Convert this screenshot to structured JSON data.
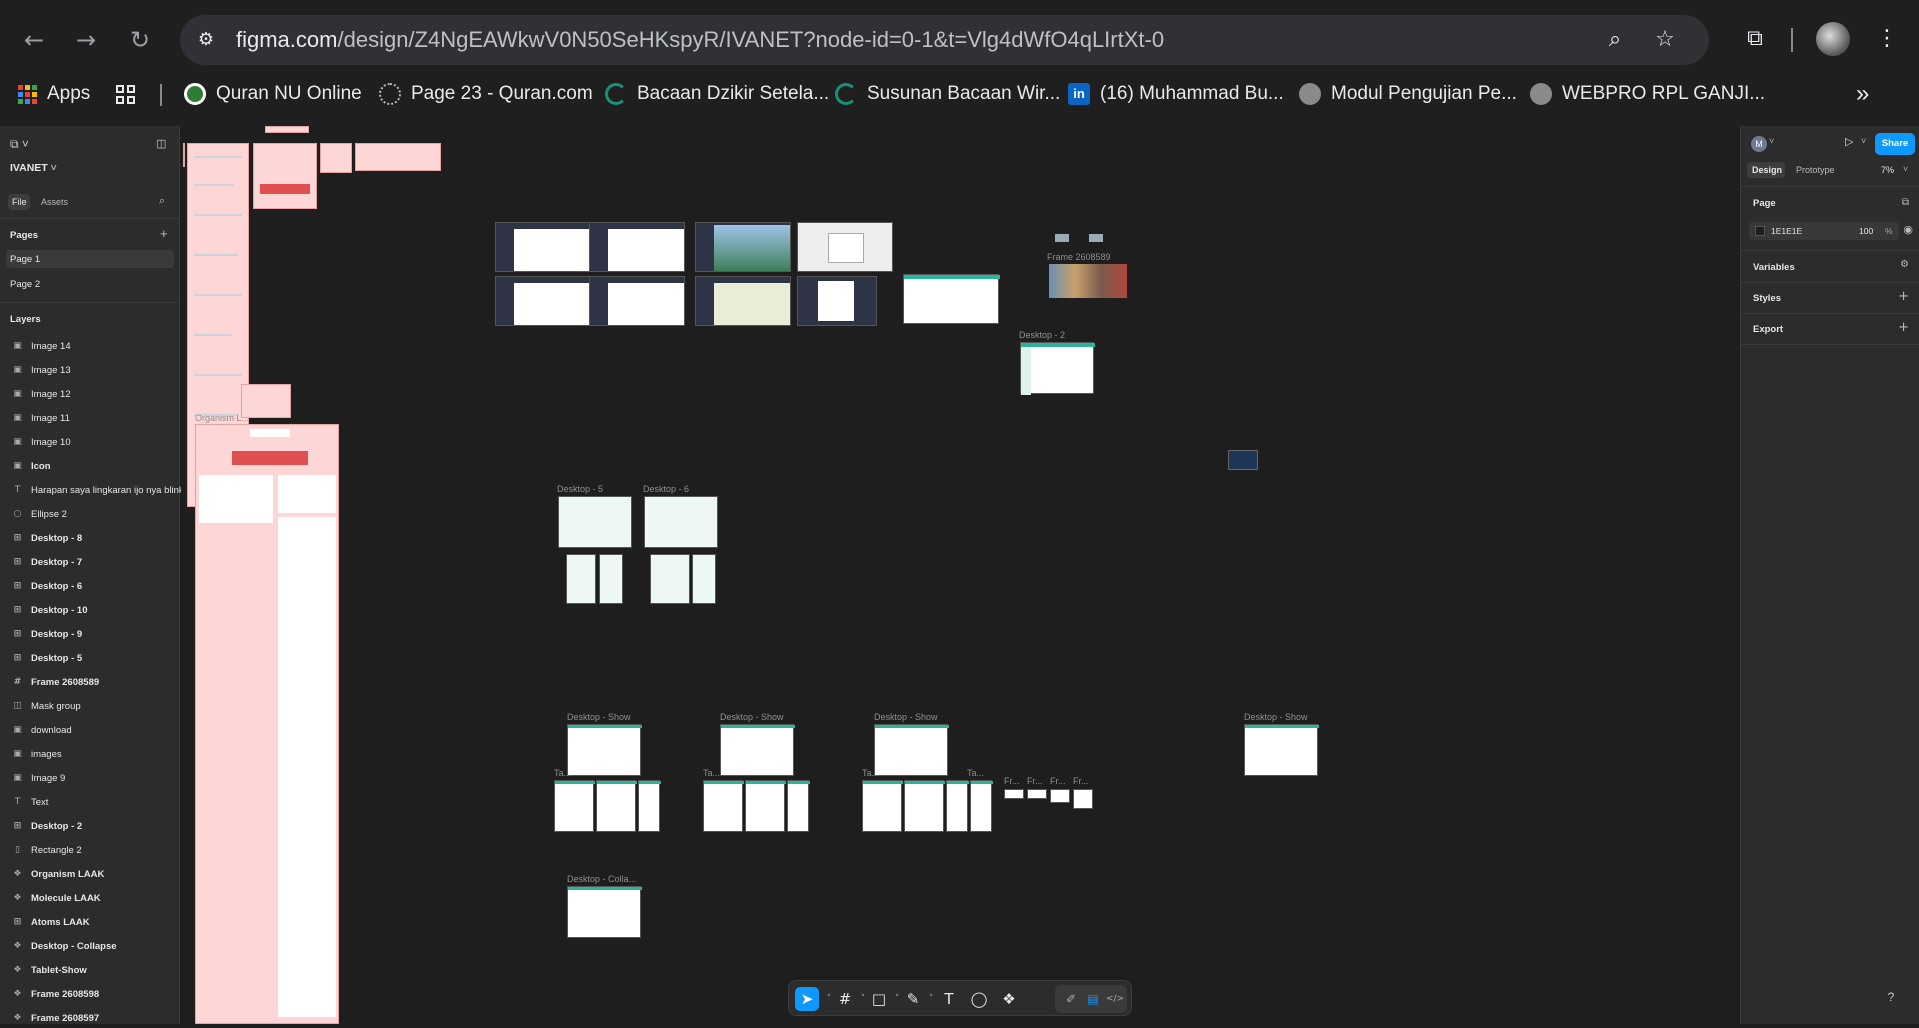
{
  "browser": {
    "url_host": "figma.com",
    "url_path": "/design/Z4NgEAWkwV0N50SeHKspyR/IVANET?node-id=0-1&t=Vlg4dWfO4qLIrtXt-0",
    "back_icon": "←",
    "forward_icon": "→",
    "reload_icon": "↻",
    "zoom_icon": "⌕",
    "star_icon": "☆",
    "extensions_icon": "⧉",
    "menu_icon": "⋮"
  },
  "bookmarks": [
    {
      "label": "Apps",
      "color": "#4285f4"
    },
    {
      "label": "Quran NU Online",
      "color": "#2e7d32"
    },
    {
      "label": "Page 23 - Quran.com",
      "color": "#6f6f6f"
    },
    {
      "label": "Bacaan Dzikir Setela...",
      "color": "#1a8f7a"
    },
    {
      "label": "Susunan Bacaan Wir...",
      "color": "#1a8f7a"
    },
    {
      "label": "(16) Muhammad Bu...",
      "color": "#0a66c2"
    },
    {
      "label": "Modul Pengujian Pe...",
      "color": "#8a8a8a"
    },
    {
      "label": "WEBPRO RPL GANJI...",
      "color": "#8a8a8a"
    }
  ],
  "bookmarks_more": "»",
  "left_panel": {
    "file_name": "IVANET",
    "tabs": {
      "file": "File",
      "assets": "Assets"
    },
    "pages_header": "Pages",
    "pages": [
      "Page 1",
      "Page 2"
    ],
    "layers_header": "Layers",
    "layers": [
      {
        "label": "Image 14",
        "icon": "▣",
        "bold": false
      },
      {
        "label": "Image 13",
        "icon": "▣",
        "bold": false
      },
      {
        "label": "Image 12",
        "icon": "▣",
        "bold": false
      },
      {
        "label": "Image 11",
        "icon": "▣",
        "bold": false
      },
      {
        "label": "Image 10",
        "icon": "▣",
        "bold": false
      },
      {
        "label": "Icon",
        "icon": "▣",
        "bold": true
      },
      {
        "label": "Harapan saya lingkaran ijo nya blink bl",
        "icon": "T",
        "bold": false
      },
      {
        "label": "Ellipse 2",
        "icon": "○",
        "bold": false
      },
      {
        "label": "Desktop - 8",
        "icon": "⊞",
        "bold": true
      },
      {
        "label": "Desktop - 7",
        "icon": "⊞",
        "bold": true
      },
      {
        "label": "Desktop - 6",
        "icon": "⊞",
        "bold": true
      },
      {
        "label": "Desktop - 10",
        "icon": "⊞",
        "bold": true
      },
      {
        "label": "Desktop - 9",
        "icon": "⊞",
        "bold": true
      },
      {
        "label": "Desktop - 5",
        "icon": "⊞",
        "bold": true
      },
      {
        "label": "Frame 2608589",
        "icon": "#",
        "bold": true
      },
      {
        "label": "Mask group",
        "icon": "◫",
        "bold": false
      },
      {
        "label": "download",
        "icon": "▣",
        "bold": false
      },
      {
        "label": "images",
        "icon": "▣",
        "bold": false
      },
      {
        "label": "Image 9",
        "icon": "▣",
        "bold": false
      },
      {
        "label": "Text",
        "icon": "T",
        "bold": false
      },
      {
        "label": "Desktop - 2",
        "icon": "⊞",
        "bold": true
      },
      {
        "label": "Rectangle 2",
        "icon": "▯",
        "bold": false
      },
      {
        "label": "Organism LAAK",
        "icon": "❖",
        "bold": true
      },
      {
        "label": "Molecule LAAK",
        "icon": "❖",
        "bold": true
      },
      {
        "label": "Atoms LAAK",
        "icon": "⊞",
        "bold": true
      },
      {
        "label": "Desktop - Collapse",
        "icon": "❖",
        "bold": true
      },
      {
        "label": "Tablet-Show",
        "icon": "❖",
        "bold": true
      },
      {
        "label": "Frame 2608598",
        "icon": "❖",
        "bold": true
      },
      {
        "label": "Frame 2608597",
        "icon": "❖",
        "bold": true
      }
    ]
  },
  "right_panel": {
    "avatar_letter": "M",
    "share_label": "Share",
    "tabs": {
      "design": "Design",
      "prototype": "Prototype"
    },
    "zoom": "7%",
    "page_section": "Page",
    "page_color_hex": "1E1E1E",
    "page_opacity": "100",
    "percent": "%",
    "variables": "Variables",
    "styles": "Styles",
    "export": "Export"
  },
  "canvas": {
    "labels": {
      "organism": "Organism L...",
      "frame_2608589": "Frame 2608589",
      "desktop_2": "Desktop - 2",
      "desktop_5": "Desktop - 5",
      "desktop_6": "Desktop - 6",
      "desktop_show": "Desktop - Show",
      "desktop_collapse": "Desktop - Colla...",
      "tablet": "Ta...",
      "fr": "Fr..."
    }
  },
  "toolbar": {
    "move": "➤",
    "frame": "#",
    "shape": "□",
    "pen": "✎",
    "text": "T",
    "comment": "◯",
    "components": "❖",
    "dev_draw": "✐",
    "dev_design": "▤",
    "dev_code": "</>"
  },
  "help_label": "?",
  "colors": {
    "accent": "#0d99ff",
    "canvas": "#1e1e1e",
    "panel": "#2c2c2c"
  }
}
